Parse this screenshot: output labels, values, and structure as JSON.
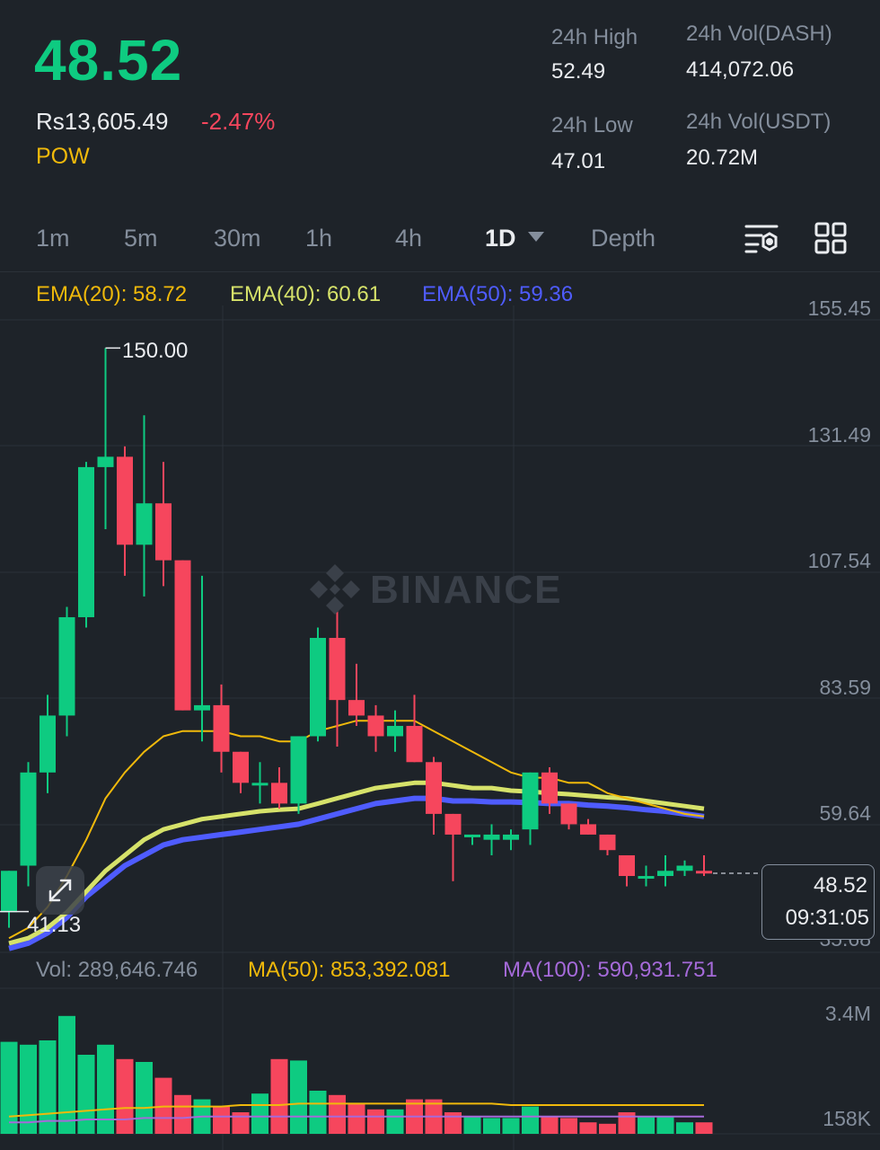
{
  "header": {
    "price": "48.52",
    "fiat_price": "Rs13,605.49",
    "change": "-2.47%",
    "tag": "POW",
    "high_label": "24h High",
    "high_value": "52.49",
    "low_label": "24h Low",
    "low_value": "47.01",
    "vol_base_label": "24h Vol(DASH)",
    "vol_base_value": "414,072.06",
    "vol_quote_label": "24h Vol(USDT)",
    "vol_quote_value": "20.72M"
  },
  "tabs": [
    "1m",
    "5m",
    "30m",
    "1h",
    "4h",
    "1D",
    "Depth"
  ],
  "active_tab": "1D",
  "indicators": {
    "ema20": "EMA(20): 58.72",
    "ema40": "EMA(40): 60.61",
    "ema50": "EMA(50): 59.36"
  },
  "price_axis": [
    "155.45",
    "131.49",
    "107.54",
    "83.59",
    "59.64",
    "35.68"
  ],
  "annotations": {
    "high_marker": "150.00",
    "low_marker": "41.13"
  },
  "watermark": "BINANCE",
  "current": {
    "price": "48.52",
    "countdown": "09:31:05"
  },
  "volume": {
    "vol": "Vol: 289,646.746",
    "ma50": "MA(50): 853,392.081",
    "ma100": "MA(100): 590,931.751",
    "axis": [
      "3.4M",
      "158K"
    ]
  },
  "colors": {
    "up": "#0ecb81",
    "down": "#f6465d",
    "ema20": "#f0b90b",
    "ema40": "#d6e26a",
    "ema50": "#4f5cff",
    "ma100": "#a56ad9"
  },
  "icons": [
    "chart-settings-icon",
    "grid-layout-icon",
    "expand-icon",
    "binance-logo-icon"
  ],
  "chart_data": {
    "type": "candlestick",
    "y_range": [
      35.68,
      155.45
    ],
    "candles": [
      {
        "o": 41,
        "h": 49,
        "l": 38,
        "c": 49
      },
      {
        "o": 50,
        "h": 70,
        "l": 46,
        "c": 68
      },
      {
        "o": 68,
        "h": 83,
        "l": 64,
        "c": 79
      },
      {
        "o": 79,
        "h": 100,
        "l": 75,
        "c": 98
      },
      {
        "o": 98,
        "h": 128,
        "l": 96,
        "c": 127
      },
      {
        "o": 127,
        "h": 150,
        "l": 115,
        "c": 129
      },
      {
        "o": 129,
        "h": 131,
        "l": 106,
        "c": 112
      },
      {
        "o": 112,
        "h": 137,
        "l": 102,
        "c": 120
      },
      {
        "o": 120,
        "h": 128,
        "l": 104,
        "c": 109
      },
      {
        "o": 109,
        "h": 109,
        "l": 80,
        "c": 80
      },
      {
        "o": 80,
        "h": 106,
        "l": 74,
        "c": 81
      },
      {
        "o": 81,
        "h": 85,
        "l": 68,
        "c": 72
      },
      {
        "o": 72,
        "h": 72,
        "l": 64,
        "c": 66
      },
      {
        "o": 66,
        "h": 70,
        "l": 62,
        "c": 66
      },
      {
        "o": 66,
        "h": 69,
        "l": 61,
        "c": 62
      },
      {
        "o": 62,
        "h": 75,
        "l": 60,
        "c": 75
      },
      {
        "o": 75,
        "h": 96,
        "l": 74,
        "c": 94
      },
      {
        "o": 94,
        "h": 100,
        "l": 73,
        "c": 82
      },
      {
        "o": 82,
        "h": 89,
        "l": 77,
        "c": 79
      },
      {
        "o": 79,
        "h": 81,
        "l": 72,
        "c": 75
      },
      {
        "o": 75,
        "h": 80,
        "l": 72,
        "c": 77
      },
      {
        "o": 77,
        "h": 83,
        "l": 70,
        "c": 70
      },
      {
        "o": 70,
        "h": 71,
        "l": 56,
        "c": 60
      },
      {
        "o": 60,
        "h": 60,
        "l": 47,
        "c": 56
      },
      {
        "o": 56,
        "h": 56,
        "l": 54,
        "c": 56
      },
      {
        "o": 55,
        "h": 58,
        "l": 52,
        "c": 56
      },
      {
        "o": 55,
        "h": 57,
        "l": 53,
        "c": 56
      },
      {
        "o": 57,
        "h": 68,
        "l": 54,
        "c": 68
      },
      {
        "o": 68,
        "h": 69,
        "l": 60,
        "c": 62
      },
      {
        "o": 62,
        "h": 62,
        "l": 57,
        "c": 58
      },
      {
        "o": 58,
        "h": 59,
        "l": 56,
        "c": 56
      },
      {
        "o": 56,
        "h": 56,
        "l": 52,
        "c": 53
      },
      {
        "o": 52,
        "h": 52,
        "l": 46,
        "c": 48
      },
      {
        "o": 48,
        "h": 50,
        "l": 46,
        "c": 48
      },
      {
        "o": 48,
        "h": 52,
        "l": 46,
        "c": 49
      },
      {
        "o": 49,
        "h": 51,
        "l": 48,
        "c": 50
      },
      {
        "o": 49,
        "h": 52,
        "l": 48,
        "c": 48.52
      }
    ],
    "ema20": [
      36,
      38,
      42,
      48,
      55,
      63,
      68,
      72,
      75,
      76,
      76,
      76,
      75,
      75,
      74,
      74,
      76,
      77,
      78,
      78,
      78,
      78,
      76,
      74,
      72,
      70,
      68,
      67,
      67,
      66,
      66,
      64,
      63,
      62,
      61,
      60,
      59.5
    ],
    "ema40": [
      35,
      36,
      38,
      41,
      45,
      49,
      52,
      55,
      57,
      58,
      59,
      59.5,
      60,
      60.5,
      60.8,
      61,
      62,
      63,
      64,
      65,
      65.5,
      66,
      66,
      65.5,
      65,
      65,
      64.5,
      64.3,
      64,
      63.8,
      63.5,
      63.2,
      63,
      62.5,
      62,
      61.5,
      61
    ],
    "ema50": [
      34,
      35,
      37,
      40,
      44,
      47,
      50,
      52,
      54,
      55,
      55.5,
      56,
      56.5,
      57,
      57.5,
      58,
      59,
      60,
      61,
      62,
      62.5,
      63,
      63,
      62.5,
      62.5,
      62.3,
      62.3,
      62.2,
      62,
      62,
      61.7,
      61.5,
      61.2,
      60.8,
      60.5,
      60,
      59.5
    ],
    "volumes": [
      0.64,
      0.62,
      0.65,
      0.82,
      0.55,
      0.62,
      0.52,
      0.5,
      0.39,
      0.27,
      0.24,
      0.19,
      0.15,
      0.28,
      0.52,
      0.51,
      0.3,
      0.27,
      0.21,
      0.17,
      0.17,
      0.24,
      0.24,
      0.15,
      0.12,
      0.11,
      0.11,
      0.19,
      0.12,
      0.11,
      0.08,
      0.07,
      0.15,
      0.12,
      0.12,
      0.08,
      0.08
    ],
    "vol_ma50": [
      0.12,
      0.13,
      0.14,
      0.15,
      0.16,
      0.17,
      0.18,
      0.18,
      0.19,
      0.19,
      0.19,
      0.19,
      0.2,
      0.2,
      0.2,
      0.21,
      0.21,
      0.21,
      0.21,
      0.21,
      0.21,
      0.21,
      0.21,
      0.21,
      0.21,
      0.21,
      0.2,
      0.2,
      0.2,
      0.2,
      0.2,
      0.2,
      0.2,
      0.2,
      0.2,
      0.2,
      0.2
    ],
    "vol_ma100": [
      0.08,
      0.08,
      0.09,
      0.09,
      0.1,
      0.1,
      0.1,
      0.11,
      0.11,
      0.11,
      0.12,
      0.12,
      0.12,
      0.12,
      0.12,
      0.12,
      0.12,
      0.12,
      0.12,
      0.12,
      0.12,
      0.12,
      0.12,
      0.12,
      0.12,
      0.12,
      0.12,
      0.12,
      0.12,
      0.12,
      0.12,
      0.12,
      0.12,
      0.12,
      0.12,
      0.12,
      0.12
    ]
  }
}
